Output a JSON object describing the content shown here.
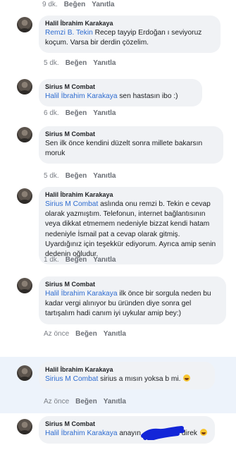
{
  "top_actions": {
    "time": "9 dk.",
    "like": "Beğen",
    "reply": "Yanıtla"
  },
  "comments": [
    {
      "author": "Halil İbrahim Karakaya",
      "tag": "Remzi B. Tekin",
      "text": " Recep tayyip Erdoğan ı seviyoruz koçum. Varsa bir derdin çözelim.",
      "time": "5 dk.",
      "like": "Beğen",
      "reply": "Yanıtla"
    },
    {
      "author": "Sirius M Combat",
      "tag": "Halil İbrahim Karakaya",
      "text": " sen hastasın ibo :)",
      "time": "6 dk.",
      "like": "Beğen",
      "reply": "Yanıtla"
    },
    {
      "author": "Sirius M Combat",
      "tag": "",
      "text": "Sen ilk önce kendini düzelt sonra millete bakarsın moruk",
      "time": "5 dk.",
      "like": "Beğen",
      "reply": "Yanıtla"
    },
    {
      "author": "Halil İbrahim Karakaya",
      "tag": "Sirius M Combat",
      "text": " aslında onu remzi b. Tekin e cevap olarak yazmıştım. Telefonun, internet bağlantısının veya dikkat etmemem nedeniyle bizzat kendi hatam nedeniyle İsmail pat a cevap olarak gitmiş. Uyardığınız için teşekkür ediyorum. Ayrıca amip senin dedenin oğludur.",
      "time": "1 dk.",
      "like": "Beğen",
      "reply": "Yanıtla"
    },
    {
      "author": "Sirius M Combat",
      "tag": "Halil İbrahim Karakaya",
      "text": " ilk önce bir sorgula neden bu kadar vergi alınıyor bu üründen diye sonra gel tartışalım hadi canım iyi uykular amip bey:)",
      "time": "Az önce",
      "like": "Beğen",
      "reply": "Yanıtla"
    },
    {
      "author": "Halil İbrahim Karakaya",
      "tag": "Sirius M Combat",
      "text": " sirius a mısın yoksa b mi.",
      "time": "Az önce",
      "like": "Beğen",
      "reply": "Yanıtla"
    },
    {
      "author": "Sirius M Combat",
      "tag": "Halil İbrahim Karakaya",
      "text_before": " anayın",
      "text_after": "direk",
      "time": "",
      "like": "",
      "reply": ""
    }
  ],
  "colors": {
    "link": "#2d6bd0",
    "bubble": "#f0f2f5",
    "highlight": "#edf3fb",
    "scribble": "#1326d8"
  }
}
